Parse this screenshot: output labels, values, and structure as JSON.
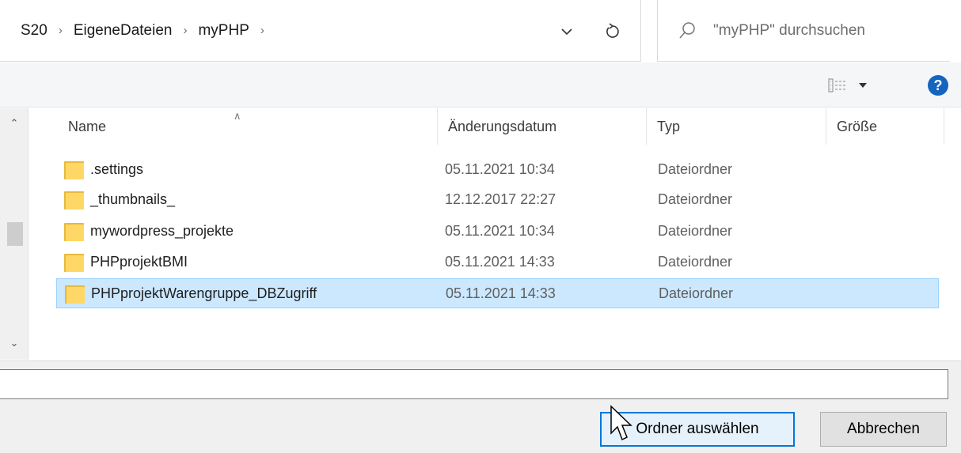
{
  "address": {
    "crumbs": [
      "S20",
      "EigeneDateien",
      "myPHP"
    ],
    "search_placeholder": "\"myPHP\" durchsuchen"
  },
  "toolbar": {
    "help_label": "?"
  },
  "columns": {
    "name": "Name",
    "date": "Änderungsdatum",
    "type": "Typ",
    "size": "Größe"
  },
  "files": [
    {
      "name": ".settings",
      "date": "05.11.2021 10:34",
      "type": "Dateiordner",
      "size": ""
    },
    {
      "name": "_thumbnails_",
      "date": "12.12.2017 22:27",
      "type": "Dateiordner",
      "size": ""
    },
    {
      "name": "mywordpress_projekte",
      "date": "05.11.2021 10:34",
      "type": "Dateiordner",
      "size": ""
    },
    {
      "name": "PHPprojektBMI",
      "date": "05.11.2021 14:33",
      "type": "Dateiordner",
      "size": ""
    },
    {
      "name": "PHPprojektWarengruppe_DBZugriff",
      "date": "05.11.2021 14:33",
      "type": "Dateiordner",
      "size": "",
      "selected": true
    }
  ],
  "footer": {
    "filename_value": "",
    "select_button": "Ordner auswählen",
    "cancel_button": "Abbrechen"
  },
  "colors": {
    "selection_bg": "#cce8ff",
    "selection_border": "#99d1ff",
    "primary_button_border": "#0078d7",
    "folder_yellow": "#ffd766",
    "help_blue": "#1565c0"
  }
}
